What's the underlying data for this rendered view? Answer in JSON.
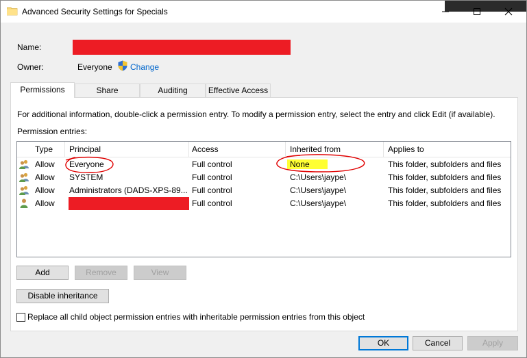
{
  "window": {
    "title": "Advanced Security Settings for Specials",
    "controls": {
      "minimize": "—",
      "maximize": "☐",
      "close": "✕"
    }
  },
  "info": {
    "name_label": "Name:",
    "owner_label": "Owner:",
    "owner_value": "Everyone",
    "change_link": "Change"
  },
  "tabs": [
    {
      "label": "Permissions",
      "active": true
    },
    {
      "label": "Share",
      "active": false
    },
    {
      "label": "Auditing",
      "active": false
    },
    {
      "label": "Effective Access",
      "active": false
    }
  ],
  "permissions": {
    "help_text": "For additional information, double-click a permission entry. To modify a permission entry, select the entry and click Edit (if available).",
    "entries_label": "Permission entries:",
    "columns": [
      "Type",
      "Principal",
      "Access",
      "Inherited from",
      "Applies to"
    ],
    "rows": [
      {
        "type": "Allow",
        "principal": "Everyone",
        "access": "Full control",
        "inherited": "None",
        "applies": "This folder, subfolders and files",
        "icon": "group-users-icon"
      },
      {
        "type": "Allow",
        "principal": "SYSTEM",
        "access": "Full control",
        "inherited": "C:\\Users\\jaype\\",
        "applies": "This folder, subfolders and files",
        "icon": "group-users-icon"
      },
      {
        "type": "Allow",
        "principal": "Administrators (DADS-XPS-89...",
        "access": "Full control",
        "inherited": "C:\\Users\\jaype\\",
        "applies": "This folder, subfolders and files",
        "icon": "group-users-icon"
      },
      {
        "type": "Allow",
        "principal": "",
        "access": "Full control",
        "inherited": "C:\\Users\\jaype\\",
        "applies": "This folder, subfolders and files",
        "icon": "single-user-icon"
      }
    ],
    "buttons": {
      "add": "Add",
      "remove": "Remove",
      "view": "View",
      "disable_inheritance": "Disable inheritance"
    },
    "replace_checkbox_label": "Replace all child object permission entries with inheritable permission entries from this object"
  },
  "footer": {
    "ok": "OK",
    "cancel": "Cancel",
    "apply": "Apply"
  },
  "colors": {
    "redaction": "#ed1c24",
    "highlight": "#ffff00",
    "link": "#0066cc",
    "accent": "#0078d7",
    "annotation": "#e00000"
  }
}
